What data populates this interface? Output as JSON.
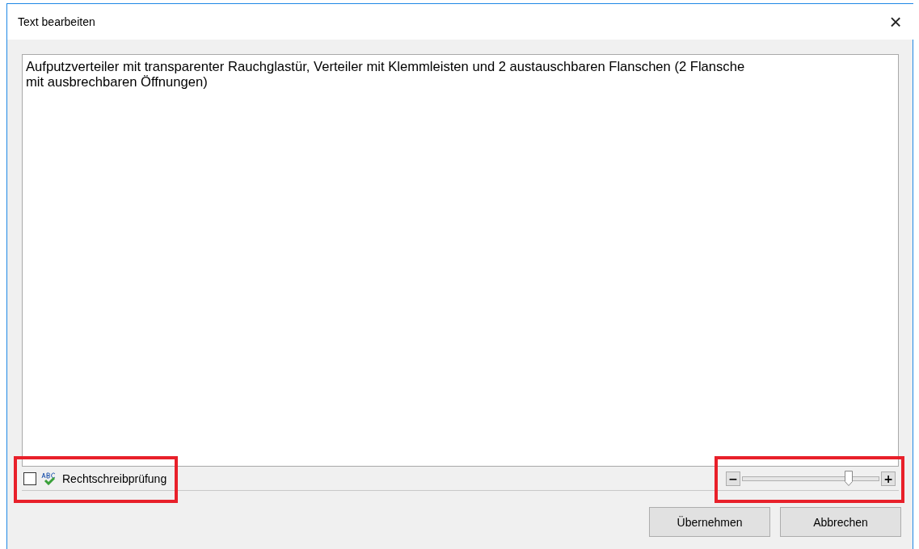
{
  "window": {
    "title": "Text bearbeiten",
    "close": "×"
  },
  "editor": {
    "lines": [
      "Aufputzverteiler mit transparenter Rauchglastür, Verteiler mit Klemmleisten und 2 austauschbaren Flanschen (2 Flansche",
      "mit ausbrechbaren Öffnungen)"
    ]
  },
  "spellcheck": {
    "label": "Rechtschreibprüfung",
    "checked": false,
    "highlighted": true
  },
  "zoom": {
    "minus": "−",
    "plus": "+",
    "level": 0.78,
    "highlighted": true
  },
  "buttons": [
    "Übernehmen",
    "Abbrechen"
  ]
}
